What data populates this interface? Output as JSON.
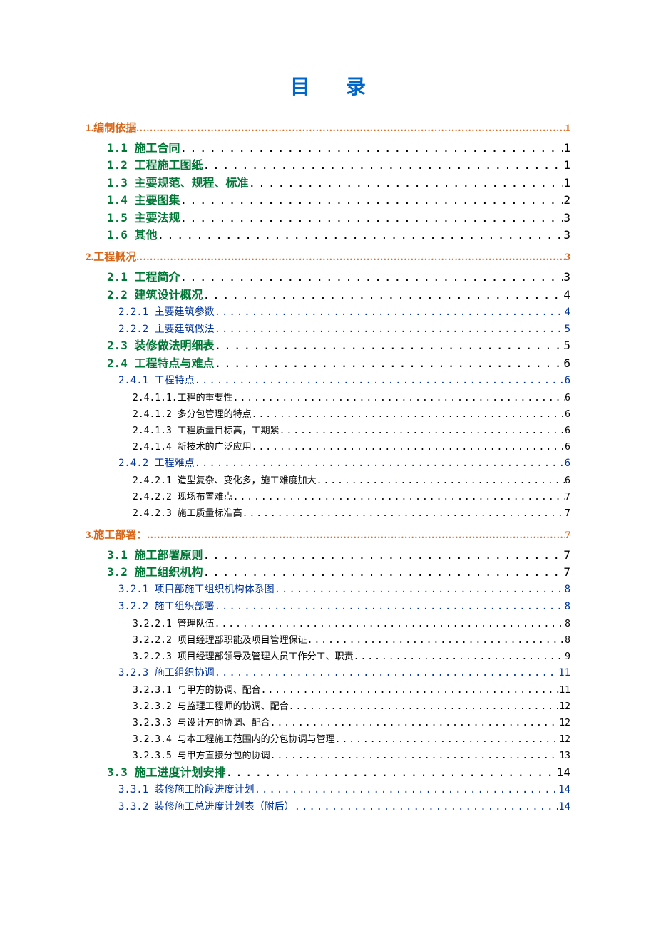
{
  "title": "目录",
  "entries": [
    {
      "level": 1,
      "label": "1.编制依据",
      "page": "1"
    },
    {
      "level": 2,
      "label": "1.1 施工合同",
      "page": "1"
    },
    {
      "level": 2,
      "label": "1.2 工程施工图纸",
      "page": "1"
    },
    {
      "level": 2,
      "label": "1.3 主要规范、规程、标准",
      "page": "1"
    },
    {
      "level": 2,
      "label": "1.4 主要图集",
      "page": "2"
    },
    {
      "level": 2,
      "label": "1.5 主要法规",
      "page": "3"
    },
    {
      "level": 2,
      "label": "1.6 其他",
      "page": "3"
    },
    {
      "level": 1,
      "label": "2.工程概况",
      "page": "3"
    },
    {
      "level": 2,
      "label": "2.1 工程简介",
      "page": "3"
    },
    {
      "level": 2,
      "label": "2.2 建筑设计概况",
      "page": "4"
    },
    {
      "level": 3,
      "label": "2.2.1 主要建筑参数",
      "page": "4"
    },
    {
      "level": 3,
      "label": "2.2.2 主要建筑做法",
      "page": "5"
    },
    {
      "level": 2,
      "label": "2.3 装修做法明细表",
      "page": "5"
    },
    {
      "level": 2,
      "label": "2.4 工程特点与难点",
      "page": "6"
    },
    {
      "level": 3,
      "label": "2.4.1 工程特点",
      "page": "6"
    },
    {
      "level": 4,
      "label": "2.4.1.1.工程的重要性",
      "page": "6"
    },
    {
      "level": 4,
      "label": "2.4.1.2 多分包管理的特点",
      "page": "6"
    },
    {
      "level": 4,
      "label": "2.4.1.3 工程质量目标高，工期紧",
      "page": "6"
    },
    {
      "level": 4,
      "label": "2.4.1.4 新技术的广泛应用",
      "page": "6"
    },
    {
      "level": 3,
      "label": "2.4.2 工程难点",
      "page": "6"
    },
    {
      "level": 4,
      "label": "2.4.2.1 造型复杂、变化多，施工难度加大",
      "page": "6"
    },
    {
      "level": 4,
      "label": "2.4.2.2 现场布置难点",
      "page": "7"
    },
    {
      "level": 4,
      "label": "2.4.2.3 施工质量标准高",
      "page": "7"
    },
    {
      "level": 1,
      "label": "3.施工部署：",
      "page": "7"
    },
    {
      "level": 2,
      "label": "3.1 施工部署原则",
      "page": "7"
    },
    {
      "level": 2,
      "label": "3.2 施工组织机构",
      "page": "7"
    },
    {
      "level": 3,
      "label": "3.2.1 项目部施工组织机构体系图",
      "page": "8"
    },
    {
      "level": 3,
      "label": "3.2.2 施工组织部署",
      "page": "8"
    },
    {
      "level": 4,
      "label": "3.2.2.1 管理队伍",
      "page": "8"
    },
    {
      "level": 4,
      "label": "3.2.2.2 项目经理部职能及项目管理保证",
      "page": "8"
    },
    {
      "level": 4,
      "label": "3.2.2.3 项目经理部领导及管理人员工作分工、职责",
      "page": "9"
    },
    {
      "level": 3,
      "label": "3.2.3 施工组织协调",
      "page": "11"
    },
    {
      "level": 4,
      "label": "3.2.3.1 与甲方的协调、配合",
      "page": "11"
    },
    {
      "level": 4,
      "label": "3.2.3.2 与监理工程师的协调、配合",
      "page": "12"
    },
    {
      "level": 4,
      "label": "3.2.3.3 与设计方的协调、配合",
      "page": "12"
    },
    {
      "level": 4,
      "label": "3.2.3.4 与本工程施工范围内的分包协调与管理",
      "page": "12"
    },
    {
      "level": 4,
      "label": "3.2.3.5 与甲方直接分包的协调",
      "page": "13"
    },
    {
      "level": 2,
      "label": "3.3 施工进度计划安排",
      "page": "14"
    },
    {
      "level": 3,
      "label": "3.3.1 装修施工阶段进度计划",
      "page": "14"
    },
    {
      "level": 3,
      "label": "3.3.2 装修施工总进度计划表（附后）",
      "page": "14"
    }
  ]
}
